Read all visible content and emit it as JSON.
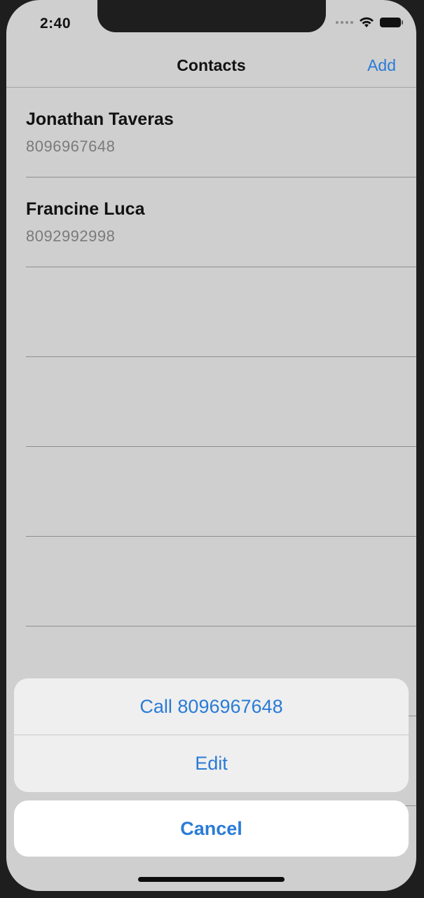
{
  "status_bar": {
    "time": "2:40",
    "icons": [
      "signal-dots-icon",
      "wifi-icon",
      "battery-icon"
    ]
  },
  "navbar": {
    "title": "Contacts",
    "add_label": "Add"
  },
  "contacts": [
    {
      "name": "Jonathan Taveras",
      "phone": "8096967648"
    },
    {
      "name": "Francine Luca",
      "phone": "8092992998"
    }
  ],
  "action_sheet": {
    "call_label": "Call 8096967648",
    "edit_label": "Edit",
    "cancel_label": "Cancel"
  },
  "colors": {
    "accent": "#2a7bd6",
    "background_dimmed": "#cfcfcf",
    "sheet_background": "#efefef"
  }
}
